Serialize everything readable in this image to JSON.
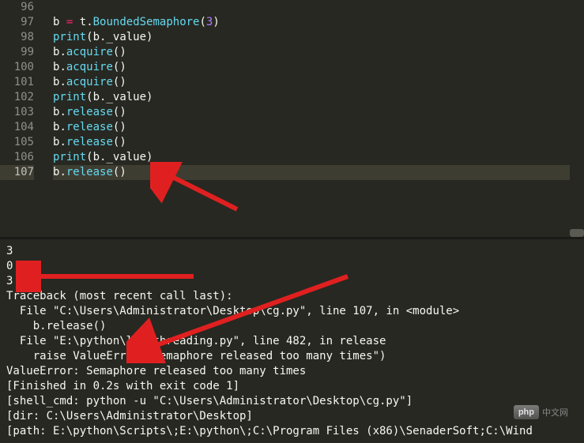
{
  "editor": {
    "lines": [
      {
        "num": "96",
        "tokens": []
      },
      {
        "num": "97",
        "tokens": [
          {
            "t": "b",
            "c": "var"
          },
          {
            "t": " ",
            "c": "var"
          },
          {
            "t": "=",
            "c": "op"
          },
          {
            "t": " ",
            "c": "var"
          },
          {
            "t": "t",
            "c": "var"
          },
          {
            "t": ".",
            "c": "dot"
          },
          {
            "t": "BoundedSemaphore",
            "c": "method"
          },
          {
            "t": "(",
            "c": "paren"
          },
          {
            "t": "3",
            "c": "num"
          },
          {
            "t": ")",
            "c": "paren"
          }
        ]
      },
      {
        "num": "98",
        "tokens": [
          {
            "t": "print",
            "c": "builtin"
          },
          {
            "t": "(",
            "c": "paren"
          },
          {
            "t": "b",
            "c": "var"
          },
          {
            "t": ".",
            "c": "dot"
          },
          {
            "t": "_value",
            "c": "attr"
          },
          {
            "t": ")",
            "c": "paren"
          }
        ]
      },
      {
        "num": "99",
        "tokens": [
          {
            "t": "b",
            "c": "var"
          },
          {
            "t": ".",
            "c": "dot"
          },
          {
            "t": "acquire",
            "c": "method"
          },
          {
            "t": "(",
            "c": "paren"
          },
          {
            "t": ")",
            "c": "paren"
          }
        ]
      },
      {
        "num": "100",
        "tokens": [
          {
            "t": "b",
            "c": "var"
          },
          {
            "t": ".",
            "c": "dot"
          },
          {
            "t": "acquire",
            "c": "method"
          },
          {
            "t": "(",
            "c": "paren"
          },
          {
            "t": ")",
            "c": "paren"
          }
        ]
      },
      {
        "num": "101",
        "tokens": [
          {
            "t": "b",
            "c": "var"
          },
          {
            "t": ".",
            "c": "dot"
          },
          {
            "t": "acquire",
            "c": "method"
          },
          {
            "t": "(",
            "c": "paren"
          },
          {
            "t": ")",
            "c": "paren"
          }
        ]
      },
      {
        "num": "102",
        "tokens": [
          {
            "t": "print",
            "c": "builtin"
          },
          {
            "t": "(",
            "c": "paren"
          },
          {
            "t": "b",
            "c": "var"
          },
          {
            "t": ".",
            "c": "dot"
          },
          {
            "t": "_value",
            "c": "attr"
          },
          {
            "t": ")",
            "c": "paren"
          }
        ]
      },
      {
        "num": "103",
        "tokens": [
          {
            "t": "b",
            "c": "var"
          },
          {
            "t": ".",
            "c": "dot"
          },
          {
            "t": "release",
            "c": "method"
          },
          {
            "t": "(",
            "c": "paren"
          },
          {
            "t": ")",
            "c": "paren"
          }
        ]
      },
      {
        "num": "104",
        "tokens": [
          {
            "t": "b",
            "c": "var"
          },
          {
            "t": ".",
            "c": "dot"
          },
          {
            "t": "release",
            "c": "method"
          },
          {
            "t": "(",
            "c": "paren"
          },
          {
            "t": ")",
            "c": "paren"
          }
        ]
      },
      {
        "num": "105",
        "tokens": [
          {
            "t": "b",
            "c": "var"
          },
          {
            "t": ".",
            "c": "dot"
          },
          {
            "t": "release",
            "c": "method"
          },
          {
            "t": "(",
            "c": "paren"
          },
          {
            "t": ")",
            "c": "paren"
          }
        ]
      },
      {
        "num": "106",
        "tokens": [
          {
            "t": "print",
            "c": "builtin"
          },
          {
            "t": "(",
            "c": "paren"
          },
          {
            "t": "b",
            "c": "var"
          },
          {
            "t": ".",
            "c": "dot"
          },
          {
            "t": "_value",
            "c": "attr"
          },
          {
            "t": ")",
            "c": "paren"
          }
        ]
      },
      {
        "num": "107",
        "active": true,
        "tokens": [
          {
            "t": "b",
            "c": "var"
          },
          {
            "t": ".",
            "c": "dot"
          },
          {
            "t": "release",
            "c": "method"
          },
          {
            "t": "(",
            "c": "paren"
          },
          {
            "t": ")",
            "c": "paren"
          }
        ]
      }
    ]
  },
  "console": {
    "lines": [
      "3",
      "0",
      "3",
      "Traceback (most recent call last):",
      "  File \"C:\\Users\\Administrator\\Desktop\\cg.py\", line 107, in <module>",
      "    b.release()",
      "  File \"E:\\python\\lib\\threading.py\", line 482, in release",
      "    raise ValueError(\"Semaphore released too many times\")",
      "ValueError: Semaphore released too many times",
      "[Finished in 0.2s with exit code 1]",
      "[shell_cmd: python -u \"C:\\Users\\Administrator\\Desktop\\cg.py\"]",
      "[dir: C:\\Users\\Administrator\\Desktop]",
      "[path: E:\\python\\Scripts\\;E:\\python\\;C:\\Program Files (x86)\\SenaderSoft;C:\\Wind"
    ]
  },
  "watermark": {
    "badge": "php",
    "text": "中文网"
  }
}
